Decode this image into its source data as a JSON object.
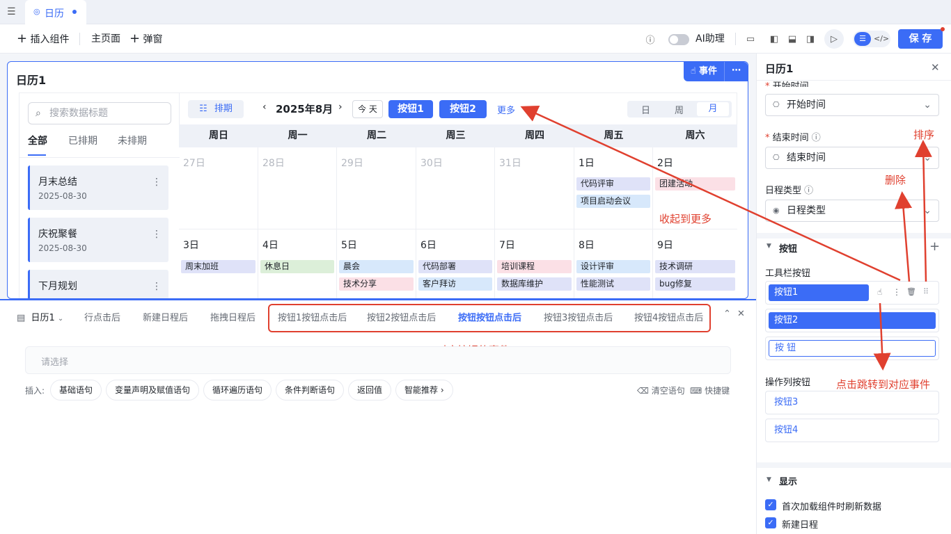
{
  "tab": {
    "title": "日历"
  },
  "toolbar": {
    "insert": "插入组件",
    "home": "主页面",
    "popup": "弹窗",
    "ai": "AI助理",
    "save": "保 存"
  },
  "card": {
    "title": "日历1",
    "event_label": "事件",
    "search_placeholder": "搜索数据标题",
    "list_tabs": [
      "全部",
      "已排期",
      "未排期"
    ],
    "items": [
      {
        "title": "月末总结",
        "date": "2025-08-30"
      },
      {
        "title": "庆祝聚餐",
        "date": "2025-08-30"
      },
      {
        "title": "下月规划"
      }
    ],
    "schedule_btn": "排期",
    "month": "2025年8月",
    "today": "今 天",
    "btn1": "按钮1",
    "btn2": "按钮2",
    "more": "更多",
    "views": [
      "日",
      "周",
      "月"
    ],
    "weekdays": [
      "周日",
      "周一",
      "周二",
      "周三",
      "周四",
      "周五",
      "周六"
    ],
    "week1": [
      "27日",
      "28日",
      "29日",
      "30日",
      "31日",
      "1日",
      "2日"
    ],
    "week2": [
      "3日",
      "4日",
      "5日",
      "6日",
      "7日",
      "8日",
      "9日"
    ],
    "events_w1": {
      "fri_a": "代码评审",
      "fri_b": "项目启动会议",
      "sat_a": "团建活动"
    },
    "events_w2": {
      "sun": "周末加班",
      "mon": "休息日",
      "tue_a": "晨会",
      "tue_b": "技术分享",
      "wed_a": "代码部署",
      "wed_b": "客户拜访",
      "thu_a": "培训课程",
      "thu_b": "数据库维护",
      "fri_a": "设计评审",
      "fri_b": "性能测试",
      "sat_a": "技术调研",
      "sat_b": "bug修复"
    }
  },
  "annotations": {
    "collapse": "收起到更多",
    "events": "对应按钮的事件",
    "sort": "排序",
    "delete": "删除",
    "jump": "点击跳转到对应事件"
  },
  "bottom": {
    "component": "日历1",
    "tabs": [
      "行点击后",
      "新建日程后",
      "拖拽日程后",
      "按钮1按钮点击后",
      "按钮2按钮点击后",
      "按钮按钮点击后",
      "按钮3按钮点击后",
      "按钮4按钮点击后"
    ],
    "select_placeholder": "请选择",
    "insert_label": "插入:",
    "insert_items": [
      "基础语句",
      "变量声明及赋值语句",
      "循环遍历语句",
      "条件判断语句",
      "返回值",
      "智能推荐 ›"
    ],
    "clear": "清空语句",
    "shortcut": "快捷键"
  },
  "panel": {
    "title": "日历1",
    "start_label": "开始时间",
    "start_value": "开始时间",
    "end_label": "结束时间",
    "end_value": "结束时间",
    "type_label": "日程类型",
    "type_value": "日程类型",
    "buttons_section": "按钮",
    "toolbar_buttons": "工具栏按钮",
    "tb_buttons": [
      "按钮1",
      "按钮2",
      "按 钮"
    ],
    "op_buttons_label": "操作列按钮",
    "op_buttons": [
      "按钮3",
      "按钮4"
    ],
    "display_section": "显示",
    "checks": [
      "首次加载组件时刷新数据",
      "新建日程"
    ]
  },
  "colors": {
    "accent": "#3b6cf6",
    "annotation": "#e0402f"
  }
}
